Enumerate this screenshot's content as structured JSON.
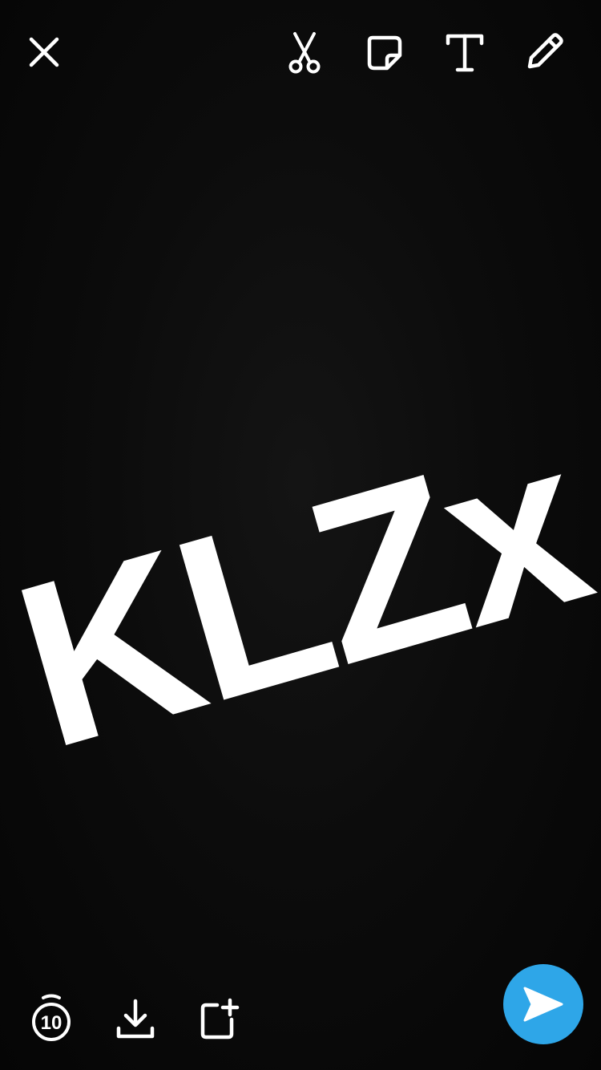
{
  "toolbar_top": {
    "close": {
      "icon": "close-icon"
    },
    "tools": [
      {
        "name": "scissors",
        "icon": "scissors-icon"
      },
      {
        "name": "sticker",
        "icon": "sticker-icon"
      },
      {
        "name": "text",
        "icon": "text-tool-icon"
      },
      {
        "name": "draw",
        "icon": "pencil-icon"
      }
    ]
  },
  "canvas": {
    "caption_text": "KLZx",
    "caption_color": "#ffffff",
    "background_color": "#0a0a0a"
  },
  "toolbar_bottom": {
    "timer": {
      "icon": "timer-icon",
      "value": "10"
    },
    "save": {
      "icon": "download-icon"
    },
    "add_to_story": {
      "icon": "add-to-story-icon"
    }
  },
  "send_button": {
    "icon": "send-arrow-icon",
    "color": "#2ea6e8"
  }
}
